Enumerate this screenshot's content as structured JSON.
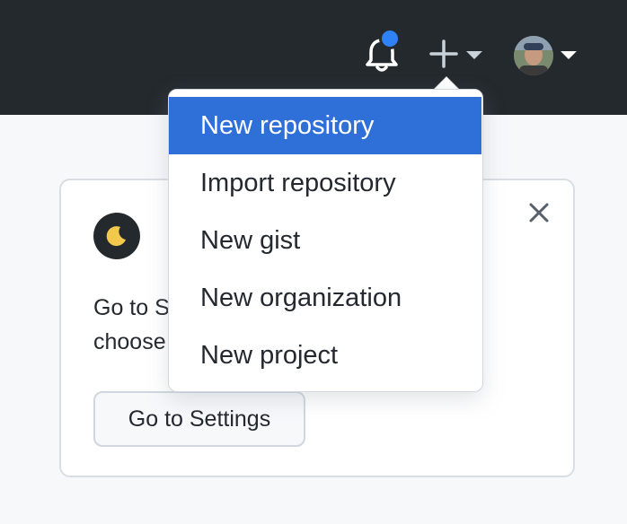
{
  "header": {
    "notifications_icon": "bell-icon",
    "create_icon": "plus-icon",
    "avatar_alt": "user-avatar",
    "colors": {
      "background": "#24292e",
      "notification_dot": "#2f81f7"
    }
  },
  "dropdown": {
    "items": [
      {
        "label": "New repository",
        "active": true
      },
      {
        "label": "Import repository",
        "active": false
      },
      {
        "label": "New gist",
        "active": false
      },
      {
        "label": "New organization",
        "active": false
      },
      {
        "label": "New project",
        "active": false
      }
    ],
    "colors": {
      "active_bg": "#2f6fd8"
    }
  },
  "card": {
    "icon": "moon-icon",
    "text_line1": "Go to S",
    "text_line2": "choose",
    "button_label": "Go to Settings",
    "close_icon": "close-icon"
  }
}
